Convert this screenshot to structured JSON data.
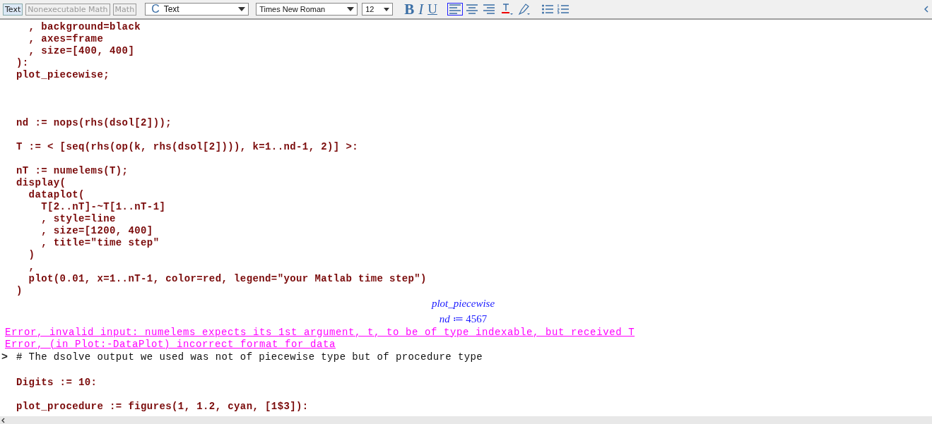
{
  "toolbar": {
    "modes": [
      {
        "label": "Text",
        "selected": true
      },
      {
        "label": "Nonexecutable Math",
        "selected": false
      },
      {
        "label": "Math",
        "selected": false
      }
    ],
    "style_dropdown": {
      "glyph": "C",
      "value": "Text"
    },
    "font_dropdown": {
      "value": "Times New Roman"
    },
    "size_dropdown": {
      "value": "12"
    },
    "format": [
      {
        "kind": "bold",
        "label": "B"
      },
      {
        "kind": "italic",
        "label": "I"
      },
      {
        "kind": "underline",
        "label": "U"
      }
    ],
    "align": [
      {
        "kind": "left",
        "selected": true
      },
      {
        "kind": "center",
        "selected": false
      },
      {
        "kind": "right",
        "selected": false
      }
    ]
  },
  "worksheet": [
    {
      "kind": "input",
      "text": "  , background=black"
    },
    {
      "kind": "input",
      "text": "  , axes=frame"
    },
    {
      "kind": "input",
      "text": "  , size=[400, 400]"
    },
    {
      "kind": "input",
      "text": "):"
    },
    {
      "kind": "input",
      "text": "plot_piecewise;"
    },
    {
      "kind": "blank"
    },
    {
      "kind": "blank"
    },
    {
      "kind": "blank"
    },
    {
      "kind": "input",
      "text": "nd := nops(rhs(dsol[2]));"
    },
    {
      "kind": "blank"
    },
    {
      "kind": "input",
      "text": "T := < [seq(rhs(op(k, rhs(dsol[2]))), k=1..nd-1, 2)] >:"
    },
    {
      "kind": "blank"
    },
    {
      "kind": "input",
      "text": "nT := numelems(T);"
    },
    {
      "kind": "input",
      "text": "display("
    },
    {
      "kind": "input",
      "text": "  dataplot("
    },
    {
      "kind": "input",
      "text": "    T[2..nT]-~T[1..nT-1]"
    },
    {
      "kind": "input",
      "text": "    , style=line"
    },
    {
      "kind": "input",
      "text": "    , size=[1200, 400]"
    },
    {
      "kind": "input",
      "text": "    , title=\"time step\""
    },
    {
      "kind": "input",
      "text": "  )"
    },
    {
      "kind": "input",
      "text": "  ,"
    },
    {
      "kind": "input",
      "text": "  plot(0.01, x=1..nT-1, color=red, legend=\"your Matlab time step\")"
    },
    {
      "kind": "input",
      "text": ")"
    },
    {
      "kind": "output",
      "text": "*plot_piecewise*"
    },
    {
      "kind": "output",
      "text": "*nd* ≔ 4567"
    },
    {
      "kind": "error",
      "text": "Error, invalid input: numelems expects its 1st argument, t, to be of type indexable, but received T"
    },
    {
      "kind": "error",
      "text": "Error, (in Plot:-DataPlot) incorrect format for data"
    },
    {
      "kind": "comment",
      "prompt": ">",
      "text": "# The dsolve output we used was not of piecewise type but of procedure type"
    },
    {
      "kind": "blank"
    },
    {
      "kind": "input",
      "text": "Digits := 10:"
    },
    {
      "kind": "blank"
    },
    {
      "kind": "input",
      "text": "plot_procedure := figures(1, 1.2, cyan, [1$3]):"
    }
  ]
}
